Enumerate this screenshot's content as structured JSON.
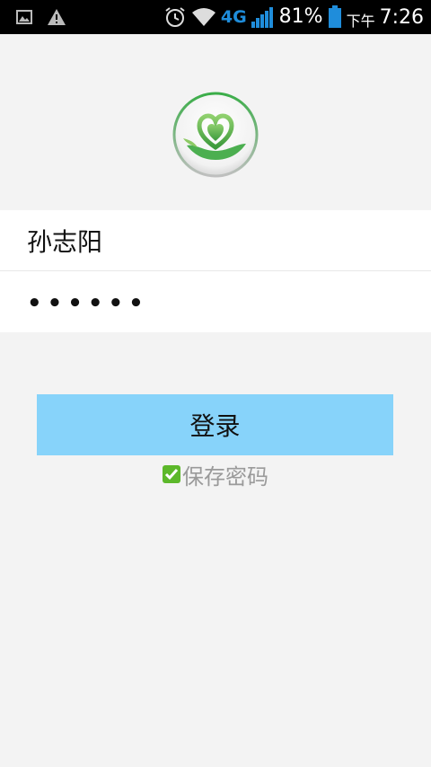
{
  "status_bar": {
    "network": "4G",
    "battery": "81%",
    "time_prefix": "下午",
    "time": "7:26"
  },
  "form": {
    "username_value": "孙志阳",
    "password_value": "••••••",
    "login_label": "登录",
    "remember_label": "保存密码",
    "remember_checked": true
  },
  "colors": {
    "background": "#f3f3f3",
    "button": "#87d3fa",
    "checkbox": "#5cb82a",
    "logo_green": "#4caf50"
  }
}
